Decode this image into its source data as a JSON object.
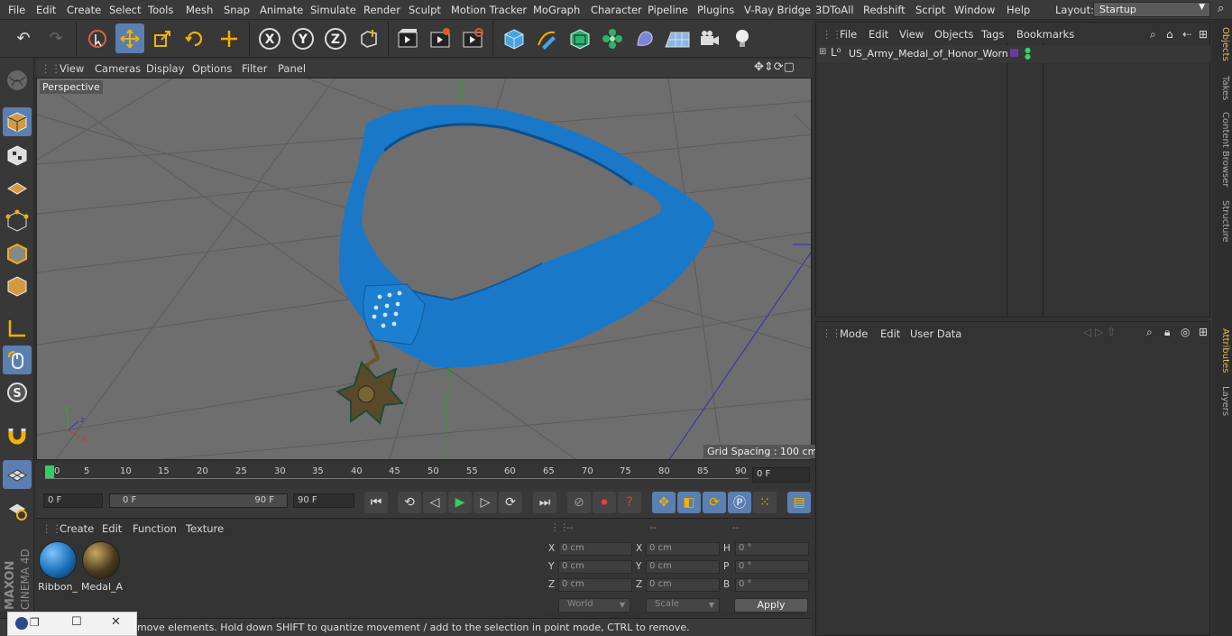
{
  "menubar": {
    "items": [
      "File",
      "Edit",
      "Create",
      "Select",
      "Tools",
      "Mesh",
      "Snap",
      "Animate",
      "Simulate",
      "Render",
      "Sculpt",
      "Motion Tracker",
      "MoGraph",
      "Character",
      "Pipeline",
      "Plugins",
      "V-Ray Bridge",
      "3DToAll",
      "Redshift",
      "Script",
      "Window",
      "Help"
    ],
    "layout_label": "Layout:",
    "layout_value": "Startup"
  },
  "toolbar": {
    "buttons": [
      "undo-icon",
      "redo-icon",
      "live-selection-icon",
      "move-icon",
      "scale-icon",
      "rotate-icon",
      "last-tool-icon",
      "x-axis-icon",
      "y-axis-icon",
      "z-axis-icon",
      "coordinate-system-icon",
      "render-view-icon",
      "render-picture-viewer-icon",
      "edit-render-settings-icon",
      "cube-icon",
      "pen-icon",
      "subdivision-icon",
      "cloner-icon",
      "deformer-icon",
      "floor-icon",
      "camera-icon",
      "light-icon"
    ],
    "axis_labels": [
      "X",
      "Y",
      "Z"
    ]
  },
  "viewport": {
    "menu": [
      "View",
      "Cameras",
      "Display",
      "Options",
      "Filter",
      "Panel"
    ],
    "label": "Perspective",
    "grid_spacing": "Grid Spacing : 100 cm"
  },
  "timeline": {
    "ticks": [
      "0",
      "5",
      "10",
      "15",
      "20",
      "25",
      "30",
      "35",
      "40",
      "45",
      "50",
      "55",
      "60",
      "65",
      "70",
      "75",
      "80",
      "85",
      "90"
    ],
    "current_frame": "0 F"
  },
  "transport": {
    "start_field": "0 F",
    "range_start": "0 F",
    "range_end": "90 F",
    "end_field": "90 F"
  },
  "materials": {
    "menu": [
      "Create",
      "Edit",
      "Function",
      "Texture"
    ],
    "items": [
      {
        "label": "Ribbon_",
        "color": "#1a6fb8"
      },
      {
        "label": "Medal_A",
        "color": "#4a3a1e"
      }
    ]
  },
  "coordinates": {
    "headers": [
      "--",
      "--",
      "--"
    ],
    "rows": [
      {
        "a": "X",
        "av": "0 cm",
        "b": "X",
        "bv": "0 cm",
        "c": "H",
        "cv": "0 °"
      },
      {
        "a": "Y",
        "av": "0 cm",
        "b": "Y",
        "bv": "0 cm",
        "c": "P",
        "cv": "0 °"
      },
      {
        "a": "Z",
        "av": "0 cm",
        "b": "Z",
        "bv": "0 cm",
        "c": "B",
        "cv": "0 °"
      }
    ],
    "space": "World",
    "mode": "Scale",
    "apply": "Apply"
  },
  "status": {
    "text": "move elements. Hold down SHIFT to quantize movement / add to the selection in point mode, CTRL to remove."
  },
  "objects": {
    "menu": [
      "File",
      "Edit",
      "View",
      "Objects",
      "Tags",
      "Bookmarks"
    ],
    "items": [
      {
        "name": "US_Army_Medal_of_Honor_Worn"
      }
    ]
  },
  "attributes": {
    "menu": [
      "Mode",
      "Edit",
      "User Data"
    ]
  },
  "right_tabs": [
    "Objects",
    "Takes",
    "Content Browser",
    "Structure",
    "Attributes",
    "Layers"
  ],
  "colors": {
    "accent": "#5a7fb0",
    "ribbon": "#1a78c8",
    "viewport_bg": "#6e6e6e"
  }
}
